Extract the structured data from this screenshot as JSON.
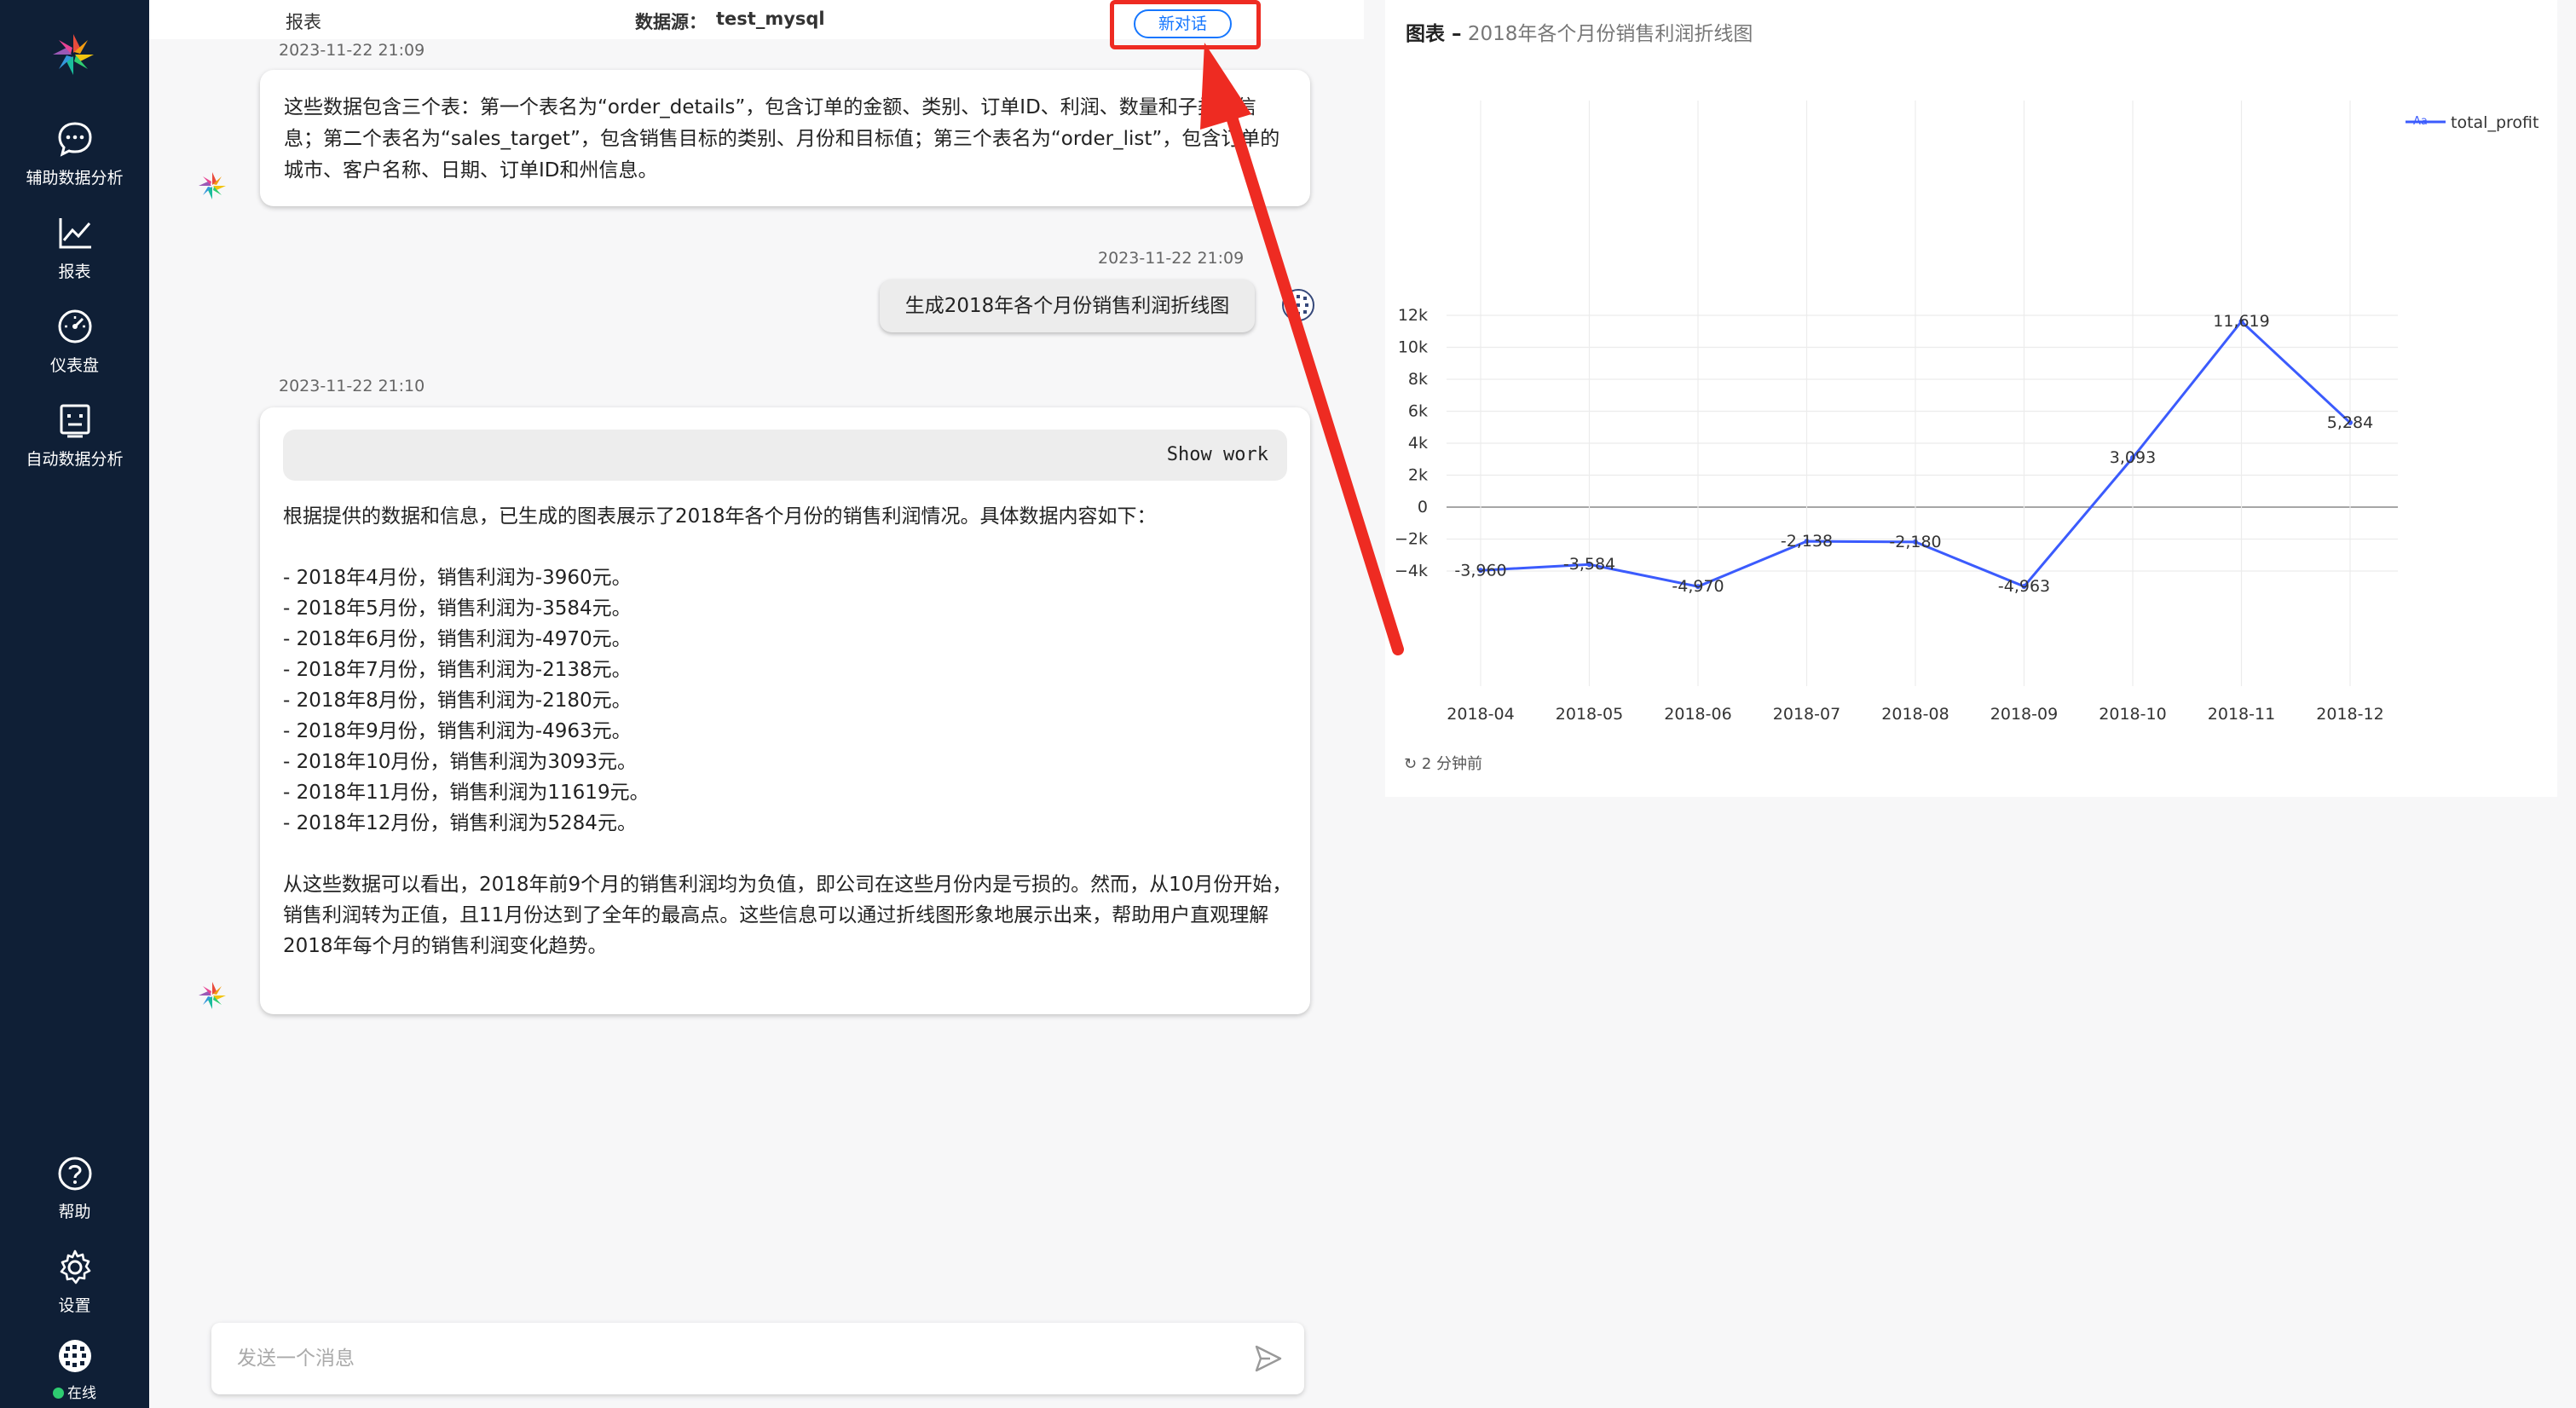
{
  "sidebar": {
    "items": [
      {
        "label": "辅助数据分析",
        "icon": "chat-bubble-icon"
      },
      {
        "label": "报表",
        "icon": "line-chart-icon"
      },
      {
        "label": "仪表盘",
        "icon": "gauge-icon"
      },
      {
        "label": "自动数据分析",
        "icon": "robot-icon"
      }
    ],
    "bottom": [
      {
        "label": "帮助",
        "icon": "help-icon"
      },
      {
        "label": "设置",
        "icon": "settings-icon"
      },
      {
        "label": "在线",
        "icon": "avatar-icon"
      }
    ]
  },
  "topbar": {
    "title": "报表",
    "datasource_label": "数据源：",
    "datasource_value": "test_mysql",
    "new_chat": "新对话"
  },
  "messages": {
    "m1": {
      "time": "2023-11-22 21:09",
      "text": "这些数据包含三个表：第一个表名为“order_details”，包含订单的金额、类别、订单ID、利润、数量和子类别信息；第二个表名为“sales_target”，包含销售目标的类别、月份和目标值；第三个表名为“order_list”，包含订单的城市、客户名称、日期、订单ID和州信息。"
    },
    "m2": {
      "time": "2023-11-22 21:09",
      "text": "生成2018年各个月份销售利润折线图"
    },
    "m3": {
      "time": "2023-11-22 21:10",
      "show_work": "Show work",
      "intro": "根据提供的数据和信息，已生成的图表展示了2018年各个月份的销售利润情况。具体数据内容如下：",
      "items": [
        "- 2018年4月份，销售利润为-3960元。",
        "- 2018年5月份，销售利润为-3584元。",
        "- 2018年6月份，销售利润为-4970元。",
        "- 2018年7月份，销售利润为-2138元。",
        "- 2018年8月份，销售利润为-2180元。",
        "- 2018年9月份，销售利润为-4963元。",
        "- 2018年10月份，销售利润为3093元。",
        "- 2018年11月份，销售利润为11619元。",
        "- 2018年12月份，销售利润为5284元。"
      ],
      "conclusion": "从这些数据可以看出，2018年前9个月的销售利润均为负值，即公司在这些月份内是亏损的。然而，从10月份开始，销售利润转为正值，且11月份达到了全年的最高点。这些信息可以通过折线图形象地展示出来，帮助用户直观理解2018年每个月的销售利润变化趋势。"
    }
  },
  "input": {
    "placeholder": "发送一个消息"
  },
  "chart_panel": {
    "title_prefix": "图表 –",
    "title": "2018年各个月份销售利润折线图",
    "refreshed": "2 分钟前",
    "legend_icon": "Aa"
  },
  "colors": {
    "sidebar": "#0f1f36",
    "accent": "#1677ff",
    "line": "#3b5bfd",
    "annotation_red": "#ee2b22"
  },
  "chart_data": {
    "type": "line",
    "title": "2018年各个月份销售利润折线图",
    "x": [
      "2018-04",
      "2018-05",
      "2018-06",
      "2018-07",
      "2018-08",
      "2018-09",
      "2018-10",
      "2018-11",
      "2018-12"
    ],
    "series": [
      {
        "name": "total_profit",
        "values": [
          -3960,
          -3584,
          -4970,
          -2138,
          -2180,
          -4963,
          3093,
          11619,
          5284
        ]
      }
    ],
    "data_labels": [
      "-3,960",
      "-3,584",
      "-4,970",
      "-2,138",
      "-2,180",
      "-4,963",
      "3,093",
      "11,619",
      "5,284"
    ],
    "yticks": [
      12000,
      10000,
      8000,
      6000,
      4000,
      2000,
      0,
      -2000,
      -4000
    ],
    "ytick_labels": [
      "12k",
      "10k",
      "8k",
      "6k",
      "4k",
      "2k",
      "0",
      "−2k",
      "−4k"
    ],
    "ylim": [
      -6000,
      12500
    ],
    "grid": true,
    "legend": "top-right"
  }
}
